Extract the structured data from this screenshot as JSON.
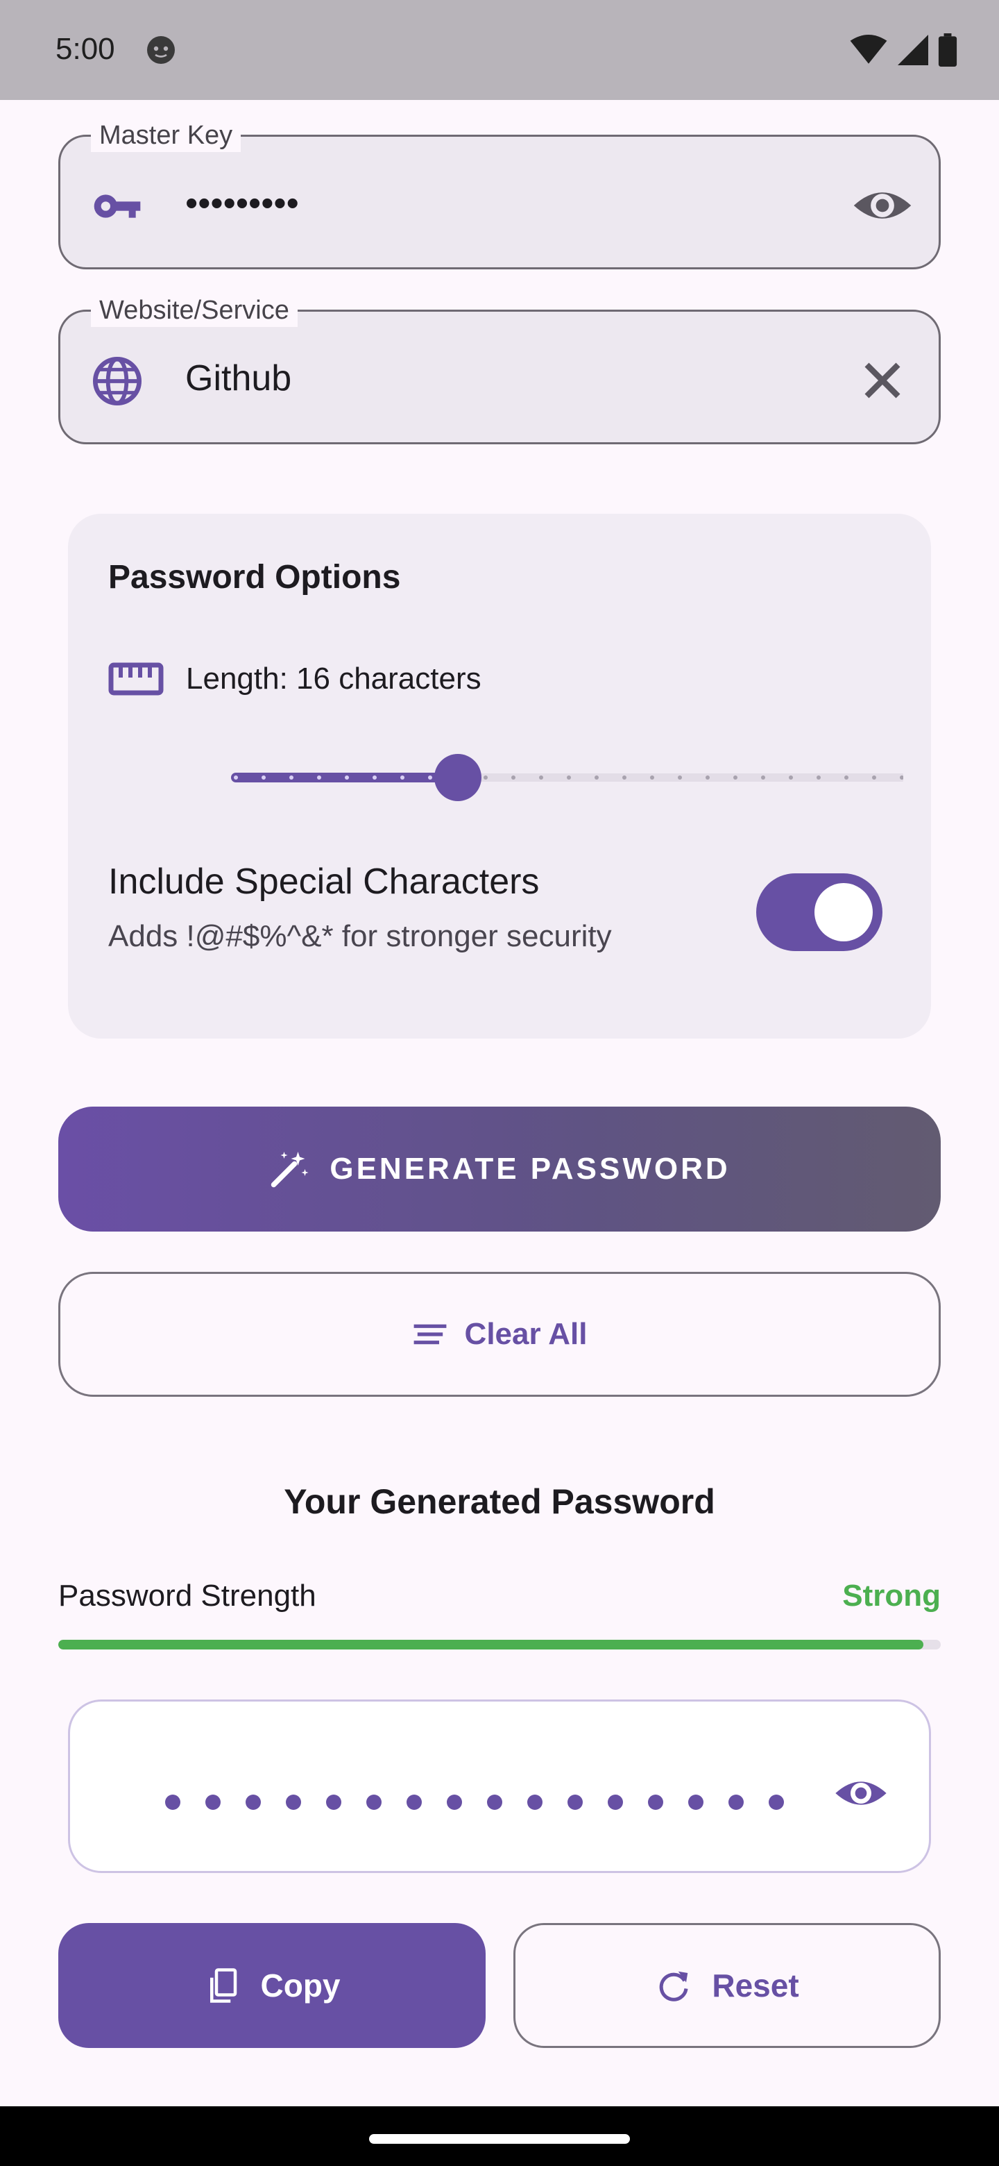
{
  "status_bar": {
    "time": "5:00"
  },
  "master_key": {
    "label": "Master Key",
    "value": "•••••••••"
  },
  "website": {
    "label": "Website/Service",
    "value": "Github"
  },
  "options": {
    "title": "Password Options",
    "length_label": "Length: 16 characters",
    "length_value": 16,
    "length_min": 8,
    "length_max": 32,
    "special_title": "Include Special Characters",
    "special_subtitle": "Adds !@#$%^&* for stronger security",
    "special_enabled": true
  },
  "actions": {
    "generate_label": "GENERATE PASSWORD",
    "clear_label": "Clear All"
  },
  "result": {
    "title": "Your Generated Password",
    "strength_label": "Password Strength",
    "strength_value": "Strong",
    "strength_fraction": 0.98,
    "masked_length": 16
  },
  "buttons": {
    "copy_label": "Copy",
    "reset_label": "Reset"
  },
  "colors": {
    "primary": "#6750a4",
    "strong": "#4caf50",
    "background": "#fdf7fd"
  },
  "icons": {
    "master_lead": "key-icon",
    "master_trail": "eye-icon",
    "website_lead": "globe-icon",
    "website_trail": "close-icon",
    "length": "ruler-icon",
    "generate": "magic-wand-icon",
    "clear": "clear-all-icon",
    "copy": "copy-icon",
    "reset": "refresh-icon"
  }
}
